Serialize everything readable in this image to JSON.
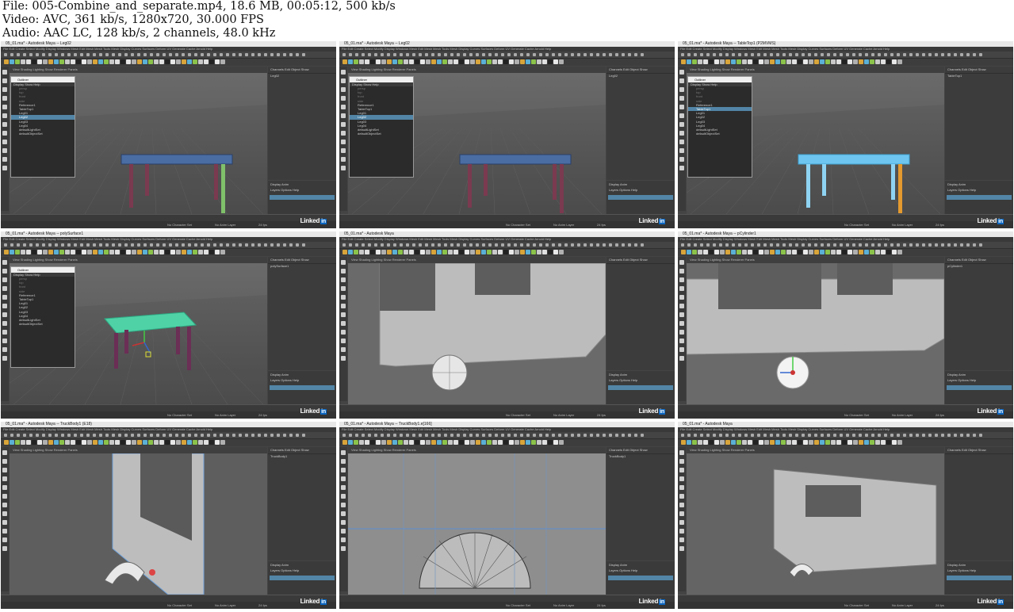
{
  "header": {
    "file_line": "File: 005-Combine_and_separate.mp4, 18.6 MB, 00:05:12, 500 kb/s",
    "video_line": "Video: AVC, 361 kb/s, 1280x720, 30.000 FPS",
    "audio_line": "Audio: AAC LC, 128 kb/s, 2 channels, 48.0 kHz"
  },
  "maya": {
    "menu": "File  Edit  Create  Select  Modify  Display  Windows  Mesh  Edit Mesh  Mesh Tools  Mesh Display  Curves  Surfaces  Deform  UV  Generate  Cache  Arnold  Help",
    "viewport_menu": "View  Shading  Lighting  Show  Renderer  Panels",
    "channel_menu": "Channels  Edit  Object  Show",
    "outliner_title": "Outliner",
    "outliner_menu": "Display  Show  Help",
    "display_tab": "Display  Anim",
    "layers_menu": "Layers  Options  Help",
    "character_set": "No Character Set",
    "anim_layer": "No Anim Layer",
    "fps": "24 fps",
    "linkedin_label": "Linked",
    "linkedin_in": "in"
  },
  "thumbnails": [
    {
      "title": "05_01.ma* - Autodesk Maya -- Leg02",
      "selected": "Leg02",
      "outliner": true
    },
    {
      "title": "05_01.ma* - Autodesk Maya -- Leg02",
      "selected": "Leg02",
      "outliner": true
    },
    {
      "title": "05_01.ma* - Autodesk Maya -- TableTop1 (P2MVMS)",
      "selected": "TableTop1",
      "outliner": true
    },
    {
      "title": "05_01.ma* - Autodesk Maya -- polySurface1",
      "selected": "polySurface1",
      "outliner": true
    },
    {
      "title": "05_01.ma* - Autodesk Maya",
      "selected": "",
      "outliner": false
    },
    {
      "title": "05_01.ma* - Autodesk Maya -- pCylinder1",
      "selected": "pCylinder1",
      "outliner": false
    },
    {
      "title": "05_01.ma* - Autodesk Maya -- TruckBody1 (E18)",
      "selected": "TruckBody1",
      "outliner": false
    },
    {
      "title": "05_01.ma* - Autodesk Maya -- TruckBody1.e[166]",
      "selected": "TruckBody1",
      "outliner": false
    },
    {
      "title": "05_01.ma* - Autodesk Maya",
      "selected": "",
      "outliner": false
    }
  ]
}
